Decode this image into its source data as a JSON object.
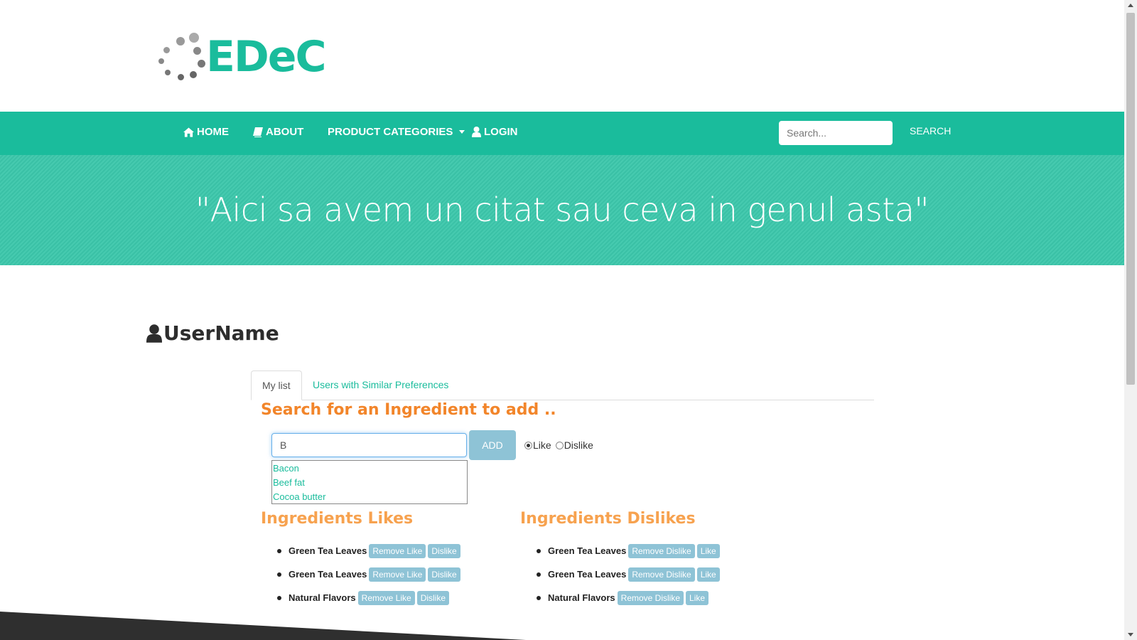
{
  "logo": {
    "text": "EDeC"
  },
  "nav": {
    "home": "HOME",
    "about": "ABOUT",
    "categories": "PRODUCT CATEGORIES",
    "login": "LOGIN",
    "search_placeholder": "Search...",
    "search_button": "SEARCH"
  },
  "banner": {
    "quote": "\"Aici sa avem un citat sau ceva in genul asta\""
  },
  "profile": {
    "username": "UserName"
  },
  "tabs": [
    {
      "label": "My list"
    },
    {
      "label": "Users with Similar Preferences"
    }
  ],
  "ingredient_search": {
    "title": "Search for an Ingredient to add ..",
    "value": "B",
    "add_button": "ADD",
    "radio_like": "Like",
    "radio_dislike": "Dislike",
    "selected": "Like",
    "suggestions": [
      "Bacon",
      "Beef fat",
      "Cocoa butter"
    ]
  },
  "likes": {
    "title": "Ingredients Likes",
    "remove_label": "Remove Like",
    "toggle_label": "Dislike",
    "items": [
      "Green Tea Leaves",
      "Green Tea Leaves",
      "Natural Flavors"
    ]
  },
  "dislikes": {
    "title": "Ingredients Dislikes",
    "remove_label": "Remove Dislike",
    "toggle_label": "Like",
    "items": [
      "Green Tea Leaves",
      "Green Tea Leaves",
      "Natural Flavors"
    ]
  },
  "colors": {
    "accent": "#1abc9c",
    "orange": "#f2852a",
    "light_orange": "#f7a24f",
    "button_blue": "#8ec3d6",
    "footer": "#2f2f2f"
  }
}
